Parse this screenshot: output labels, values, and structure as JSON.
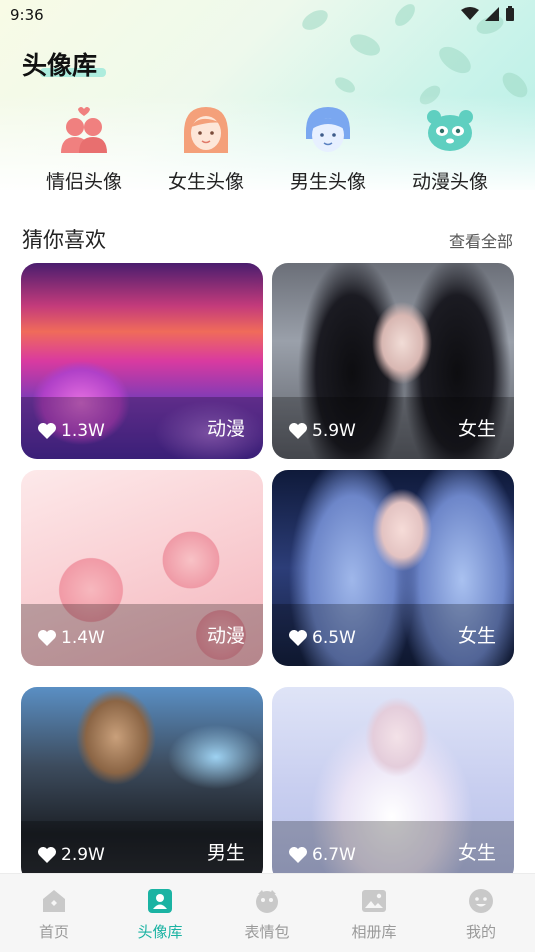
{
  "status": {
    "time": "9:36"
  },
  "page_title": "头像库",
  "categories": [
    {
      "label": "情侣头像",
      "icon": "couple-icon",
      "color": "#f0807f"
    },
    {
      "label": "女生头像",
      "icon": "girl-icon",
      "color": "#f4a07a"
    },
    {
      "label": "男生头像",
      "icon": "boy-icon",
      "color": "#7aa7f0"
    },
    {
      "label": "动漫头像",
      "icon": "panda-icon",
      "color": "#5fcfc0"
    }
  ],
  "section": {
    "title": "猜你喜欢",
    "see_all": "查看全部"
  },
  "cards": [
    {
      "likes": "1.3W",
      "tag": "动漫"
    },
    {
      "likes": "5.9W",
      "tag": "女生"
    },
    {
      "likes": "1.4W",
      "tag": "动漫"
    },
    {
      "likes": "6.5W",
      "tag": "女生"
    },
    {
      "likes": "2.9W",
      "tag": "男生"
    },
    {
      "likes": "6.7W",
      "tag": "女生"
    }
  ],
  "tabs": [
    {
      "label": "首页",
      "icon": "home-icon"
    },
    {
      "label": "头像库",
      "icon": "avatar-library-icon",
      "active": true
    },
    {
      "label": "表情包",
      "icon": "emoji-pack-icon"
    },
    {
      "label": "相册库",
      "icon": "album-icon"
    },
    {
      "label": "我的",
      "icon": "profile-icon"
    }
  ],
  "colors": {
    "accent": "#1bb3a3",
    "inactive": "#9a9a9a"
  }
}
